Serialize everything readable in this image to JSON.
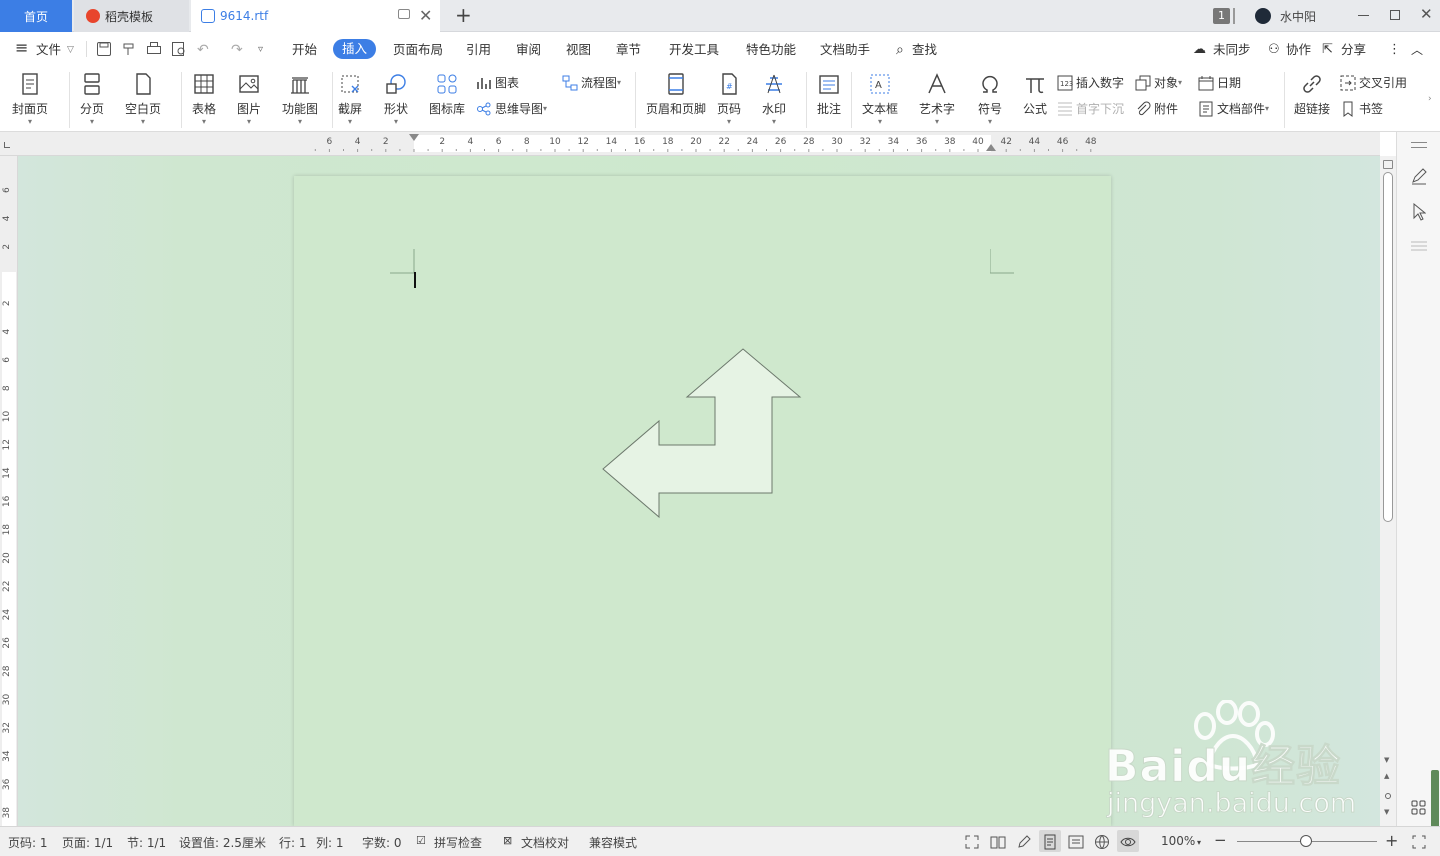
{
  "tabs": {
    "home": "首页",
    "template": "稻壳模板",
    "document": "9614.rtf",
    "new_tab": "+"
  },
  "titlebar": {
    "badge": "1",
    "user": "水中阳"
  },
  "menu": {
    "file": "文件",
    "items": [
      "开始",
      "插入",
      "页面布局",
      "引用",
      "审阅",
      "视图",
      "章节",
      "开发工具",
      "特色功能",
      "文档助手"
    ],
    "active": "插入",
    "search": "查找",
    "sync": "未同步",
    "collab": "协作",
    "share": "分享"
  },
  "ribbon": {
    "cover": "封面页",
    "pagebreak": "分页",
    "blank": "空白页",
    "table": "表格",
    "picture": "图片",
    "funcmap": "功能图",
    "screenshot": "截屏",
    "shape": "形状",
    "iconlib": "图标库",
    "chart": "图表",
    "flowchart": "流程图",
    "mindmap": "思维导图",
    "header_footer": "页眉和页脚",
    "page_number": "页码",
    "watermark": "水印",
    "comment": "批注",
    "textbox": "文本框",
    "wordart": "艺术字",
    "symbol": "符号",
    "formula": "公式",
    "insert_number": "插入数字",
    "dropcap": "首字下沉",
    "object": "对象",
    "attachment": "附件",
    "date": "日期",
    "doc_parts": "文档部件",
    "hyperlink": "超链接",
    "cross_ref": "交叉引用",
    "bookmark": "书签"
  },
  "ruler": {
    "h_left": [
      "6",
      "4",
      "2"
    ],
    "h_right": [
      "2",
      "4",
      "6",
      "8",
      "10",
      "12",
      "14",
      "16",
      "18",
      "20",
      "22",
      "24",
      "26",
      "28",
      "30",
      "32",
      "34",
      "36",
      "38",
      "40",
      "42",
      "44",
      "46",
      "48"
    ],
    "v_top": [
      "6",
      "4",
      "2"
    ],
    "v_bottom": [
      "2",
      "4",
      "6",
      "8",
      "10",
      "12",
      "14",
      "16",
      "18",
      "20",
      "22",
      "24",
      "26",
      "28",
      "30",
      "32",
      "34",
      "36",
      "38"
    ]
  },
  "status": {
    "page_code": "页码: 1",
    "pages": "页面: 1/1",
    "section": "节: 1/1",
    "setting": "设置值: 2.5厘米",
    "row": "行: 1",
    "col": "列: 1",
    "words": "字数: 0",
    "spell": "拼写检查",
    "proof": "文档校对",
    "compat": "兼容模式",
    "zoom": "100%"
  },
  "watermark": {
    "brand": "Baidu经验",
    "url": "jingyan.baidu.com"
  },
  "colors": {
    "accent": "#3c7ee5",
    "page_bg": "#cfe8cd",
    "shape_fill": "#e6f3e4"
  }
}
